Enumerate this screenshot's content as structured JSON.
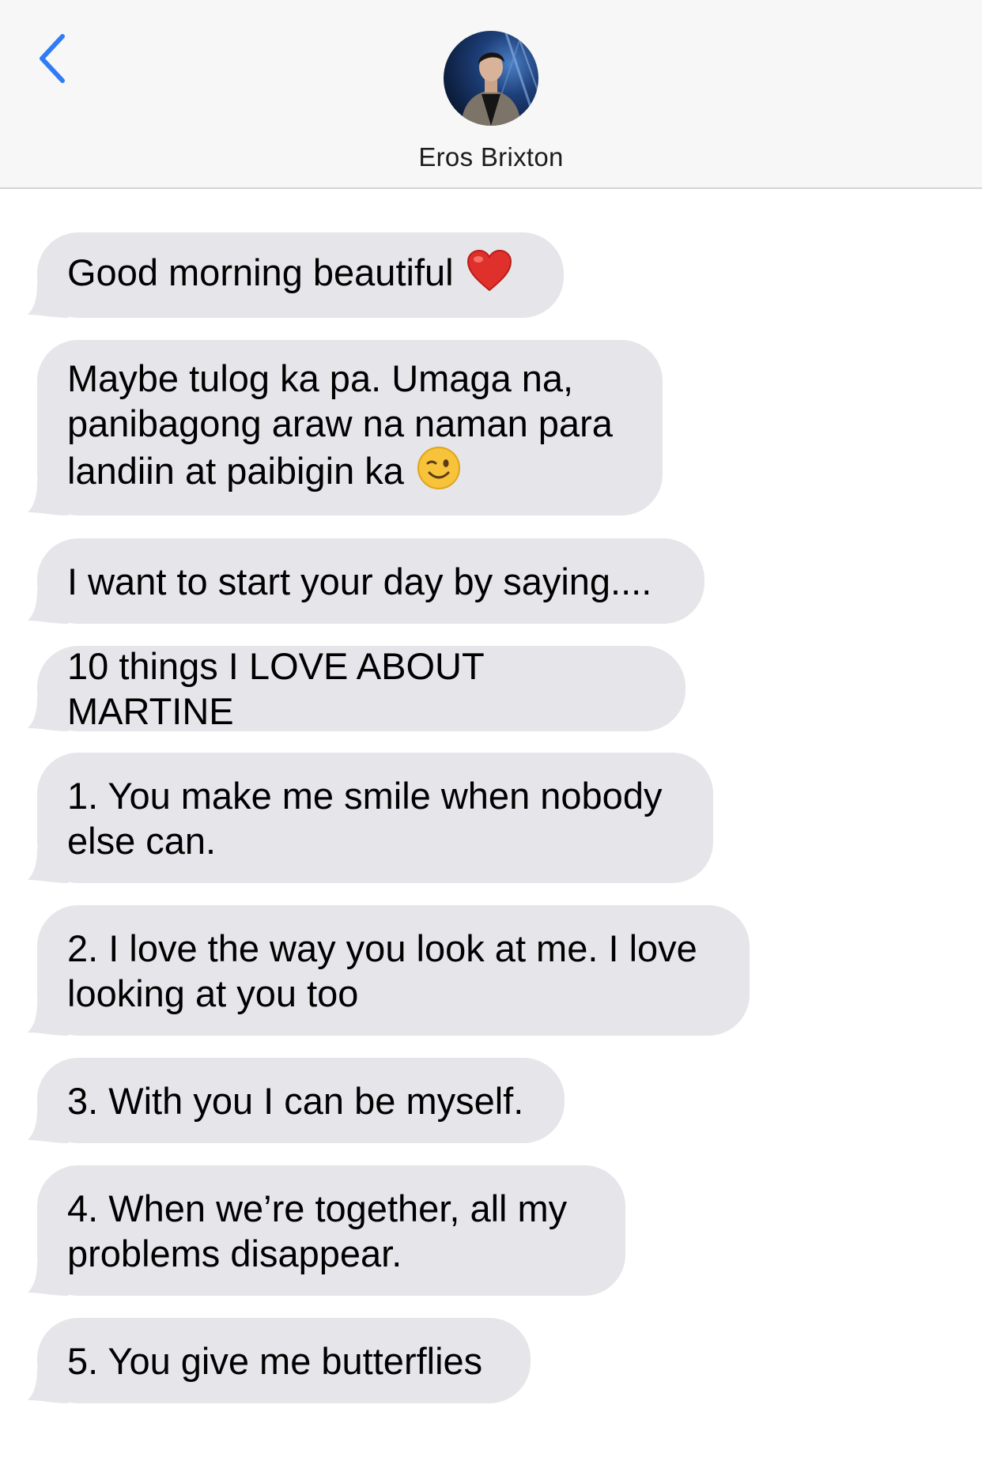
{
  "header": {
    "contact_name": "Eros Brixton",
    "accent_color": "#2f7cf6",
    "back_icon": "chevron-left-icon",
    "avatar_icon": "contact-photo"
  },
  "bubble_color": "#e5e5ea",
  "messages": [
    {
      "text": "Good morning beautiful",
      "emoji": "red-heart"
    },
    {
      "text": "Maybe tulog ka pa. Umaga na, panibagong araw na naman para landiin at paibigin ka",
      "emoji": "winking-face"
    },
    {
      "text": "I want to start your day by saying...."
    },
    {
      "text": "10 things I LOVE ABOUT MARTINE"
    },
    {
      "text": "1. You make me smile when nobody else can."
    },
    {
      "text": "2. I love the way you look at me. I love looking at you too"
    },
    {
      "text": "3. With you I can be myself."
    },
    {
      "text": "4. When we’re together, all my problems disappear."
    },
    {
      "text": "5. You give me butterflies"
    }
  ]
}
